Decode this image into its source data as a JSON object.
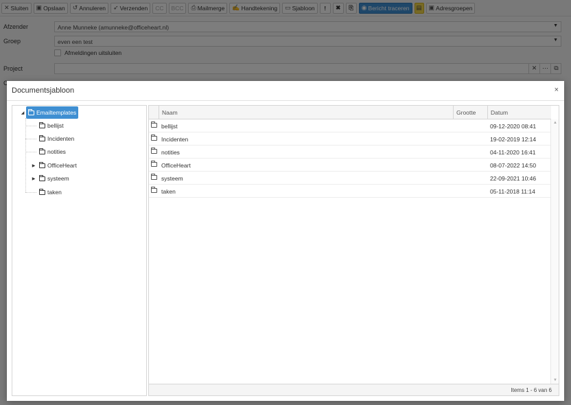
{
  "toolbar": {
    "close": "Sluiten",
    "save": "Opslaan",
    "cancel": "Annuleren",
    "send": "Verzenden",
    "cc": "CC",
    "bcc": "BCC",
    "mailmerge": "Mailmerge",
    "signature": "Handtekening",
    "template": "Sjabloon",
    "priority": "!",
    "track": "Bericht traceren",
    "addressgroups": "Adresgroepen"
  },
  "form": {
    "sender_label": "Afzender",
    "sender_value": "Anne Munneke (amunneke@officeheart.nl)",
    "group_label": "Groep",
    "group_value": "even een test",
    "unsubscribe_label": "Afmeldingen uitsluiten",
    "project_label": "Project",
    "project_value": "",
    "next_label": "C"
  },
  "dialog": {
    "title": "Documentsjabloon",
    "close": "×",
    "tree": {
      "root": "Emailtemplates",
      "children": [
        {
          "label": "bellijst",
          "expandable": false
        },
        {
          "label": "Incidenten",
          "expandable": false
        },
        {
          "label": "notities",
          "expandable": false
        },
        {
          "label": "OfficeHeart",
          "expandable": true
        },
        {
          "label": "systeem",
          "expandable": true
        },
        {
          "label": "taken",
          "expandable": false
        }
      ]
    },
    "grid": {
      "columns": {
        "name": "Naam",
        "size": "Grootte",
        "date": "Datum"
      },
      "rows": [
        {
          "name": "bellijst",
          "size": "",
          "date": "09-12-2020 08:41"
        },
        {
          "name": "Incidenten",
          "size": "",
          "date": "19-02-2019 12:14"
        },
        {
          "name": "notities",
          "size": "",
          "date": "04-11-2020 16:41"
        },
        {
          "name": "OfficeHeart",
          "size": "",
          "date": "08-07-2022 14:50"
        },
        {
          "name": "systeem",
          "size": "",
          "date": "22-09-2021 10:46"
        },
        {
          "name": "taken",
          "size": "",
          "date": "05-11-2018 11:14"
        }
      ],
      "pager_info": "Items 1 - 6 van 6"
    }
  }
}
